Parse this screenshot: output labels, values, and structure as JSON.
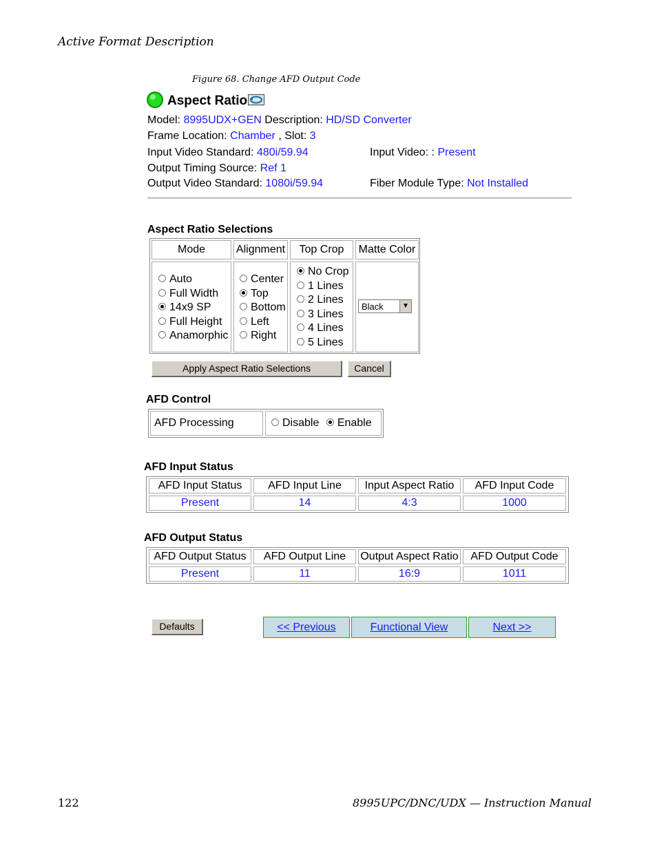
{
  "header": {
    "running_head": "Active Format Description"
  },
  "figure": {
    "caption": "Figure 68.  Change AFD Output Code"
  },
  "panel": {
    "title": "Aspect Ratio",
    "model_label": "Model: ",
    "model_value": "8995UDX+GEN",
    "description_label": " Description: ",
    "description_value": "HD/SD Converter",
    "frame_label": "Frame Location: ",
    "frame_value": "Chamber",
    "slot_label": " , Slot: ",
    "slot_value": "3",
    "input_std_label": "Input Video Standard: ",
    "input_std_value": "480i/59.94",
    "input_video_label": "Input Video:   : ",
    "input_video_value": "Present",
    "timing_label": "Output Timing Source: ",
    "timing_value": "Ref 1",
    "output_std_label": "Output Video Standard: ",
    "output_std_value": "1080i/59.94",
    "fiber_label": "Fiber Module Type: ",
    "fiber_value": "Not Installed"
  },
  "aspect": {
    "heading": "Aspect Ratio Selections",
    "headers": [
      "Mode",
      "Alignment",
      "Top Crop",
      "Matte Color"
    ],
    "mode_options": [
      {
        "label": "Auto",
        "checked": false
      },
      {
        "label": "Full Width",
        "checked": false
      },
      {
        "label": "14x9 SP",
        "checked": true
      },
      {
        "label": "Full Height",
        "checked": false
      },
      {
        "label": "Anamorphic",
        "checked": false
      }
    ],
    "alignment_options": [
      {
        "label": "Center",
        "checked": false
      },
      {
        "label": "Top",
        "checked": true
      },
      {
        "label": "Bottom",
        "checked": false
      },
      {
        "label": "Left",
        "checked": false
      },
      {
        "label": "Right",
        "checked": false
      }
    ],
    "crop_options": [
      {
        "label": "No Crop",
        "checked": true
      },
      {
        "label": "1 Lines",
        "checked": false
      },
      {
        "label": "2 Lines",
        "checked": false
      },
      {
        "label": "3 Lines",
        "checked": false
      },
      {
        "label": "4 Lines",
        "checked": false
      },
      {
        "label": "5 Lines",
        "checked": false
      }
    ],
    "matte_value": "Black",
    "apply_label": "Apply Aspect Ratio Selections",
    "cancel_label": "Cancel"
  },
  "afd_control": {
    "heading": "AFD Control",
    "processing_label": "AFD Processing",
    "disable_label": "Disable",
    "enable_label": "Enable"
  },
  "afd_input": {
    "heading": "AFD Input Status",
    "headers": [
      "AFD Input Status",
      "AFD Input Line",
      "Input Aspect Ratio",
      "AFD Input Code"
    ],
    "values": [
      "Present",
      "14",
      "4:3",
      "1000"
    ]
  },
  "afd_output": {
    "heading": "AFD Output Status",
    "headers": [
      "AFD Output Status",
      "AFD Output Line",
      "Output Aspect Ratio",
      "AFD Output Code"
    ],
    "values": [
      "Present",
      "11",
      "16:9",
      "1011"
    ]
  },
  "nav": {
    "defaults_label": "Defaults",
    "previous_label": "<< Previous",
    "functional_label": "Functional View",
    "next_label": "Next >>"
  },
  "footer": {
    "page_number": "122",
    "manual_title": "8995UPC/DNC/UDX  —  Instruction Manual"
  },
  "colors": {
    "link": "#1a1aff",
    "nav_bg": "#c8dce6",
    "nav_border": "#2f9a2f",
    "status_green": "#22cc22"
  }
}
